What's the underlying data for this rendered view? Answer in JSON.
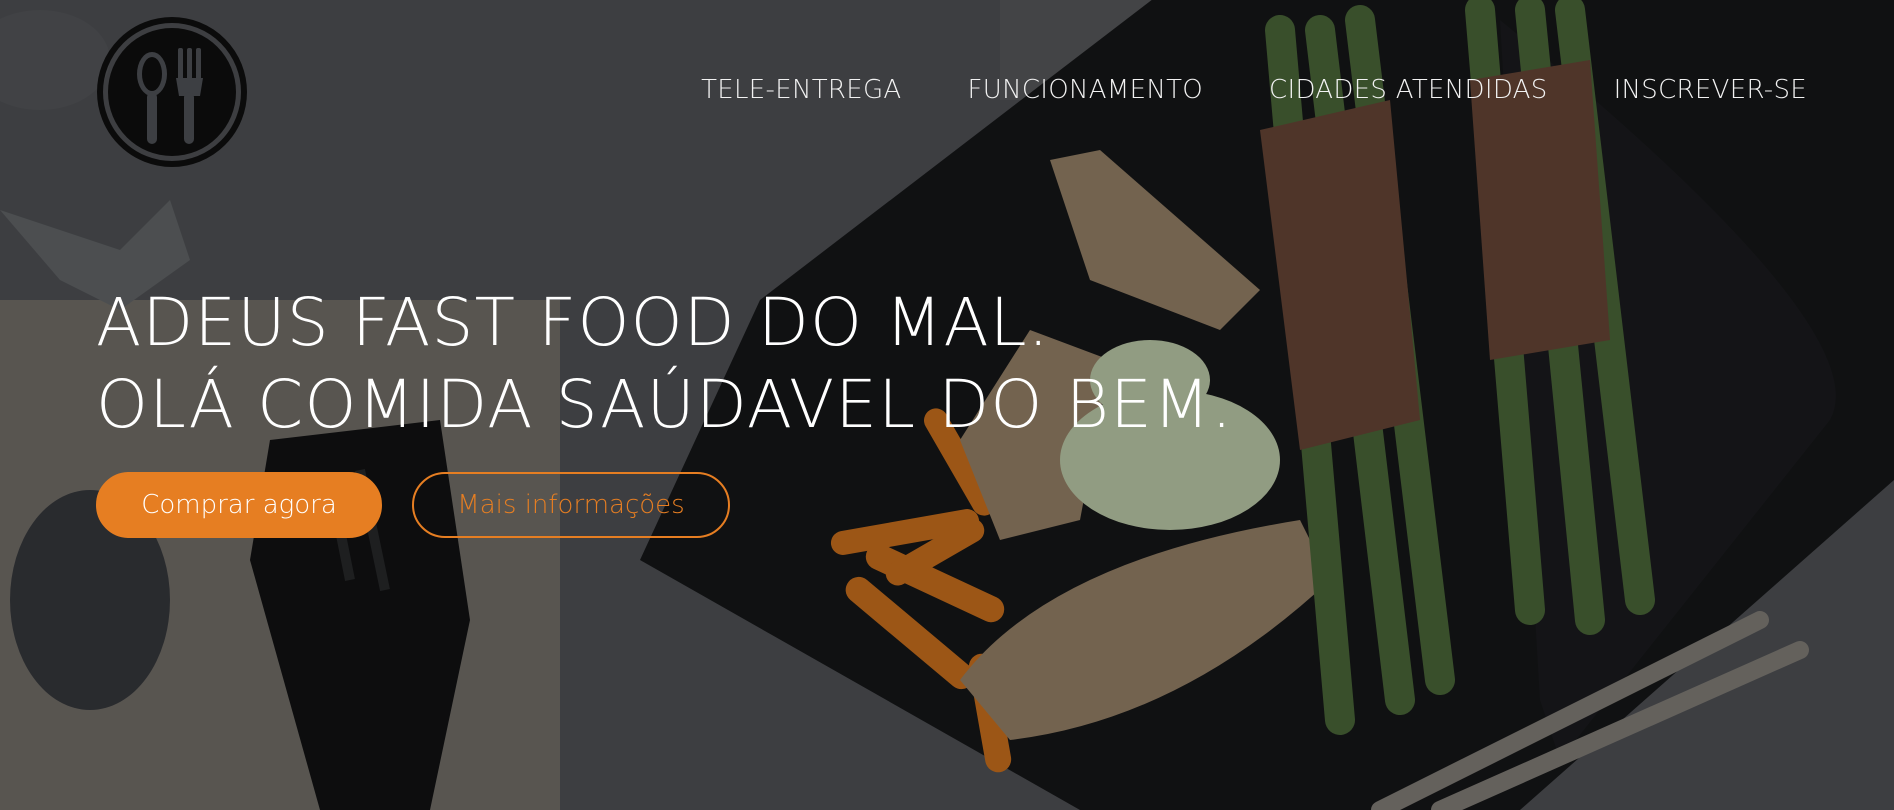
{
  "colors": {
    "accent": "#e67e22",
    "text": "#ffffff"
  },
  "logo": {
    "icon": "spoon-fork-icon"
  },
  "nav": {
    "items": [
      {
        "label": "TELE-ENTREGA"
      },
      {
        "label": "FUNCIONAMENTO"
      },
      {
        "label": "CIDADES ATENDIDAS"
      },
      {
        "label": "INSCREVER-SE"
      }
    ]
  },
  "hero": {
    "headline_line1": "ADEUS FAST FOOD DO MAL.",
    "headline_line2": "OLÁ COMIDA SAÚDAVEL DO BEM.",
    "primary_button": "Comprar agora",
    "secondary_button": "Mais informações"
  }
}
